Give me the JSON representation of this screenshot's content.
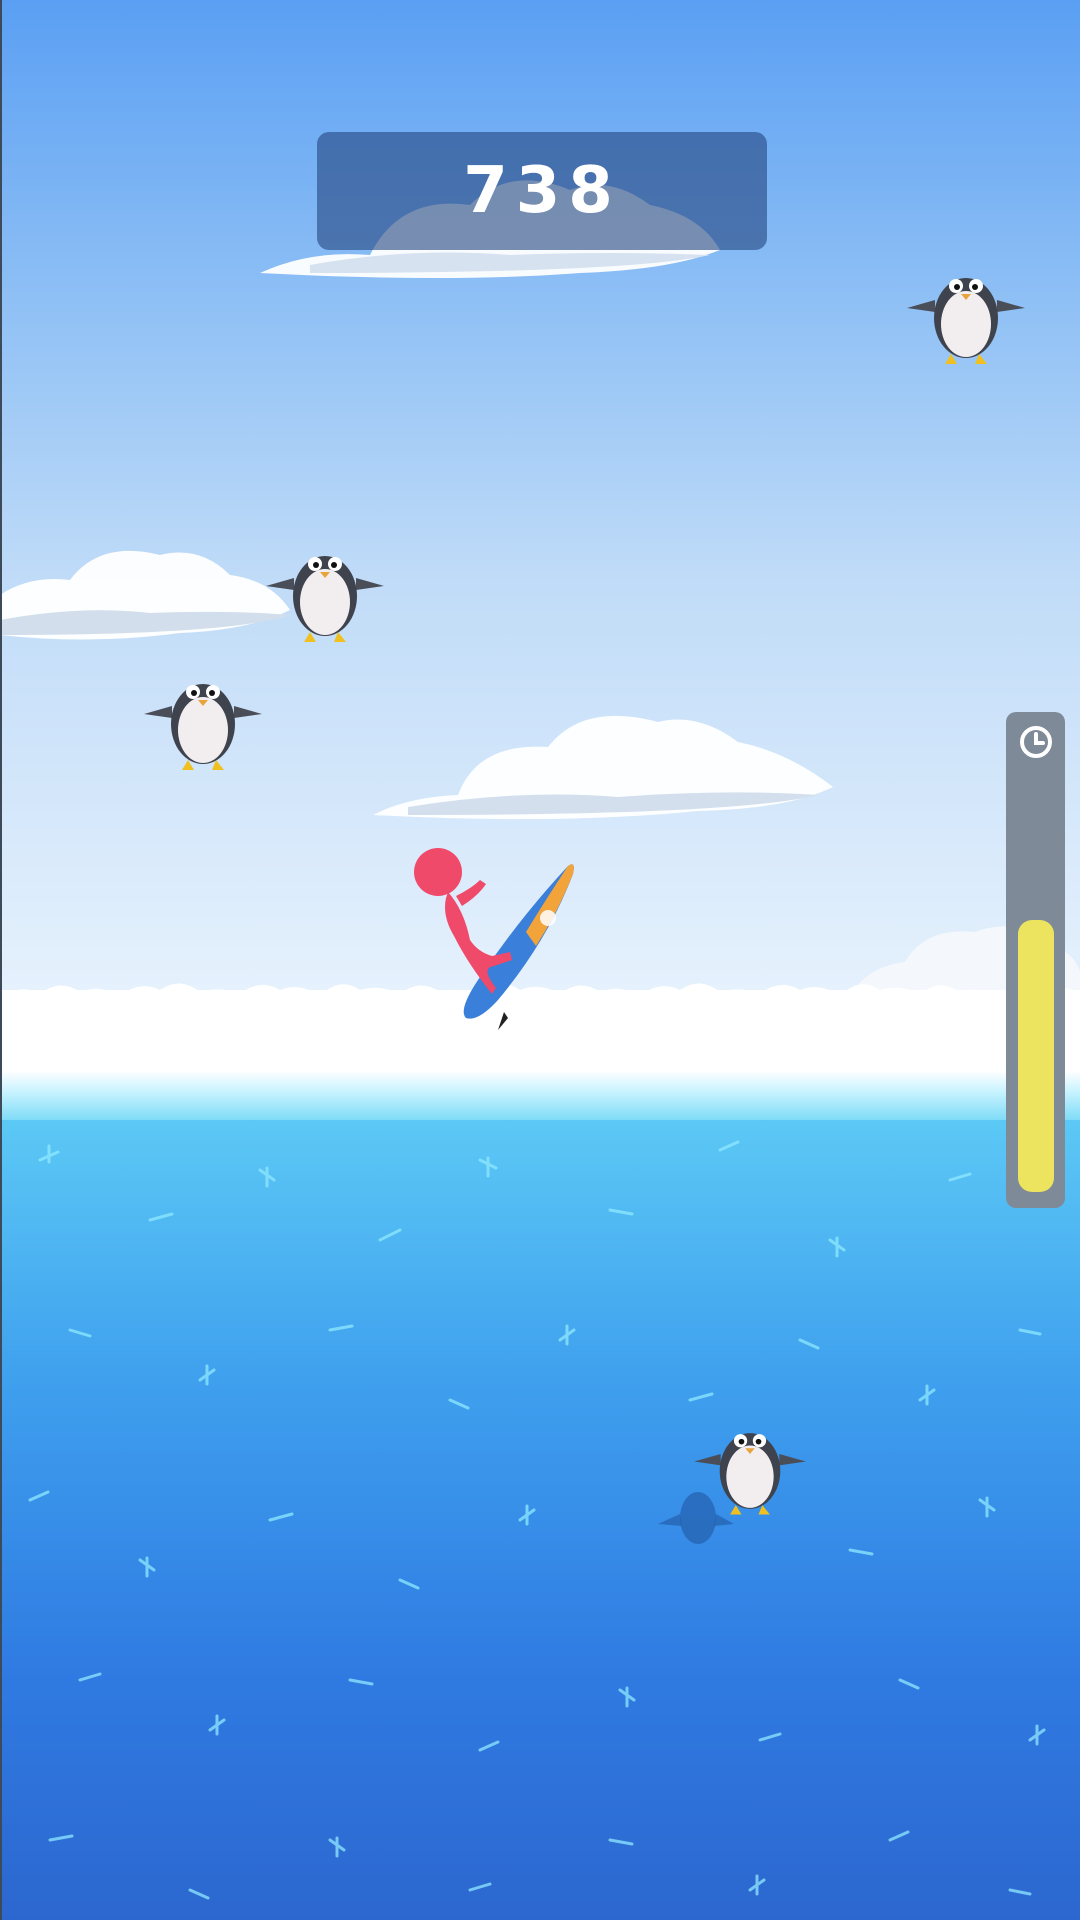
{
  "game": {
    "score": "738",
    "timer": {
      "icon": "clock-icon",
      "level": 0.68,
      "fill_color": "#ece35e"
    },
    "colors": {
      "sky_top": "#5a9ff3",
      "sea": "#3fa0ee",
      "player": "#f04a6a",
      "board_orange": "#f2a33a",
      "board_blue": "#3a7fd9"
    }
  }
}
